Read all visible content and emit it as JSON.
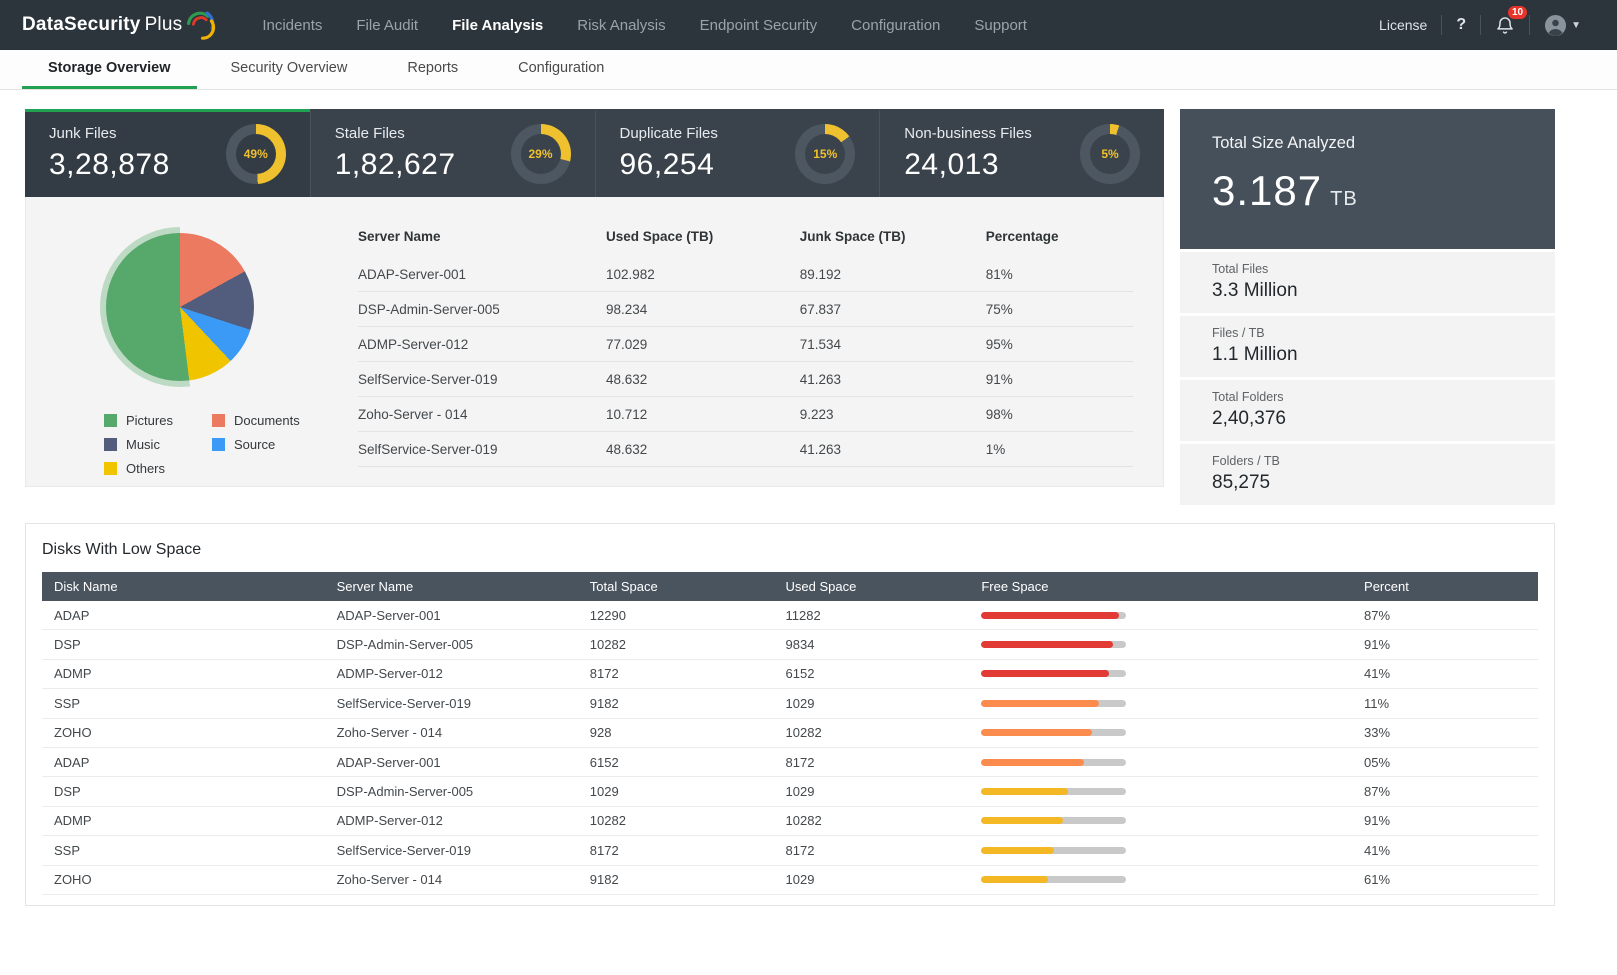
{
  "topbar": {
    "brand": {
      "name": "DataSecurity",
      "suffix": "Plus"
    },
    "nav": [
      {
        "label": "Incidents",
        "active": false
      },
      {
        "label": "File Audit",
        "active": false
      },
      {
        "label": "File Analysis",
        "active": true
      },
      {
        "label": "Risk Analysis",
        "active": false
      },
      {
        "label": "Endpoint Security",
        "active": false
      },
      {
        "label": "Configuration",
        "active": false
      },
      {
        "label": "Support",
        "active": false
      }
    ],
    "license_label": "License",
    "help_label": "?",
    "notification_count": "10"
  },
  "subnav": {
    "tabs": [
      {
        "label": "Storage Overview",
        "active": true
      },
      {
        "label": "Security Overview",
        "active": false
      },
      {
        "label": "Reports",
        "active": false
      },
      {
        "label": "Configuration",
        "active": false
      }
    ]
  },
  "stat_cards": [
    {
      "label": "Junk Files",
      "value": "3,28,878",
      "percent_label": "49%",
      "percent": 49,
      "active": true
    },
    {
      "label": "Stale Files",
      "value": "1,82,627",
      "percent_label": "29%",
      "percent": 29,
      "active": false
    },
    {
      "label": "Duplicate Files",
      "value": "96,254",
      "percent_label": "15%",
      "percent": 15,
      "active": false
    },
    {
      "label": "Non-business Files",
      "value": "24,013",
      "percent_label": "5%",
      "percent": 5,
      "active": false
    }
  ],
  "donut_colors": {
    "arc": "#f0c12f",
    "rest": "#4d5761"
  },
  "chart_data": {
    "type": "pie",
    "title": "File type distribution",
    "slices_draw_order": [
      {
        "label": "Documents",
        "value": 17,
        "color": "#ec7a60"
      },
      {
        "label": "Music",
        "value": 13,
        "color": "#525d7d"
      },
      {
        "label": "Source",
        "value": 8,
        "color": "#3b9af5"
      },
      {
        "label": "Others",
        "value": 10,
        "color": "#f1c400"
      },
      {
        "label": "Pictures",
        "value": 52,
        "color": "#57a86b"
      }
    ],
    "legend": [
      {
        "label": "Pictures",
        "color": "#57a86b"
      },
      {
        "label": "Documents",
        "color": "#ec7a60"
      },
      {
        "label": "Music",
        "color": "#525d7d"
      },
      {
        "label": "Source",
        "color": "#3b9af5"
      },
      {
        "label": "Others",
        "color": "#f1c400"
      }
    ],
    "highlight_halo_color": "rgba(87,168,107,0.35)"
  },
  "junk_table": {
    "headers": [
      "Server Name",
      "Used Space (TB)",
      "Junk Space (TB)",
      "Percentage"
    ],
    "rows": [
      [
        "ADAP-Server-001",
        "102.982",
        "89.192",
        "81%"
      ],
      [
        "DSP-Admin-Server-005",
        "98.234",
        "67.837",
        "75%"
      ],
      [
        "ADMP-Server-012",
        "77.029",
        "71.534",
        "95%"
      ],
      [
        "SelfService-Server-019",
        "48.632",
        "41.263",
        "91%"
      ],
      [
        "Zoho-Server - 014",
        "10.712",
        "9.223",
        "98%"
      ],
      [
        "SelfService-Server-019",
        "48.632",
        "41.263",
        "1%"
      ]
    ]
  },
  "side_panel": {
    "title": "Total Size Analyzed",
    "value": "3.187",
    "unit": "TB",
    "stats": [
      {
        "label": "Total Files",
        "value": "3.3 Million"
      },
      {
        "label": "Files / TB",
        "value": "1.1 Million"
      },
      {
        "label": "Total Folders",
        "value": "2,40,376"
      },
      {
        "label": "Folders / TB",
        "value": "85,275"
      }
    ]
  },
  "low_space": {
    "title": "Disks With Low Space",
    "headers": [
      "Disk Name",
      "Server Name",
      "Total Space",
      "Used Space",
      "Free Space",
      "Percent"
    ],
    "rows": [
      {
        "disk": "ADAP",
        "server": "ADAP-Server-001",
        "total": "12290",
        "used": "11282",
        "fill": 95,
        "color": "#e23b35",
        "percent": "87%"
      },
      {
        "disk": "DSP",
        "server": "DSP-Admin-Server-005",
        "total": "10282",
        "used": "9834",
        "fill": 91,
        "color": "#e23b35",
        "percent": "91%"
      },
      {
        "disk": "ADMP",
        "server": "ADMP-Server-012",
        "total": "8172",
        "used": "6152",
        "fill": 88,
        "color": "#e23b35",
        "percent": "41%"
      },
      {
        "disk": "SSP",
        "server": "SelfService-Server-019",
        "total": "9182",
        "used": "1029",
        "fill": 81,
        "color": "#fb8c4d",
        "percent": "11%"
      },
      {
        "disk": "ZOHO",
        "server": "Zoho-Server - 014",
        "total": "928",
        "used": "10282",
        "fill": 76,
        "color": "#fb8c4d",
        "percent": "33%"
      },
      {
        "disk": "ADAP",
        "server": "ADAP-Server-001",
        "total": "6152",
        "used": "8172",
        "fill": 71,
        "color": "#fb8c4d",
        "percent": "05%"
      },
      {
        "disk": "DSP",
        "server": "DSP-Admin-Server-005",
        "total": "1029",
        "used": "1029",
        "fill": 60,
        "color": "#f5b825",
        "percent": "87%"
      },
      {
        "disk": "ADMP",
        "server": "ADMP-Server-012",
        "total": "10282",
        "used": "10282",
        "fill": 56,
        "color": "#f5b825",
        "percent": "91%"
      },
      {
        "disk": "SSP",
        "server": "SelfService-Server-019",
        "total": "8172",
        "used": "8172",
        "fill": 50,
        "color": "#f5b825",
        "percent": "41%"
      },
      {
        "disk": "ZOHO",
        "server": "Zoho-Server - 014",
        "total": "9182",
        "used": "1029",
        "fill": 46,
        "color": "#f5b825",
        "percent": "61%"
      }
    ]
  }
}
